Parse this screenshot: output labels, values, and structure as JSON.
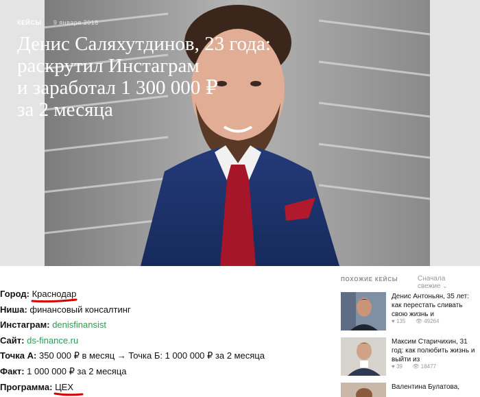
{
  "hero": {
    "category": "Кейсы",
    "date": "9 января 2018",
    "title_lines": [
      "Денис Саляхутдинов, 23 года:",
      "раскрутил Инстаграм",
      "и заработал 1 300 000 ₽",
      "за 2 месяца"
    ]
  },
  "article": {
    "city": {
      "label": "Город:",
      "value": "Краснодар"
    },
    "niche": {
      "label": "Ниша:",
      "value": "финансовый консалтинг"
    },
    "instagram": {
      "label": "Инстаграм:",
      "value": "denisfinansist"
    },
    "site": {
      "label": "Сайт:",
      "value": "ds-finance.ru"
    },
    "points": {
      "label": "Точка А:",
      "value": "350 000 ₽ в месяц → Точка Б: 1 000 000 ₽ за 2 месяца"
    },
    "fact": {
      "label": "Факт:",
      "value": "1 000 000 ₽ за 2 месяца"
    },
    "program": {
      "label": "Программа:",
      "value": "ЦЕХ"
    }
  },
  "sidebar": {
    "title": "Похожие кейсы",
    "sort": "Сначала свежие",
    "items": [
      {
        "title": "Денис Антоньян, 35 лет: как перестать сливать свою жизнь и",
        "likes": "135",
        "views": "49264"
      },
      {
        "title": "Максим Старичихин, 31 год: как полюбить жизнь и выйти из",
        "likes": "39",
        "views": "18477"
      },
      {
        "title": "Валентина Булатова,",
        "likes": "",
        "views": ""
      }
    ]
  },
  "colors": {
    "link_green": "#2d9b4d",
    "annotation_red": "#d40000",
    "muted_gray": "#999999"
  }
}
